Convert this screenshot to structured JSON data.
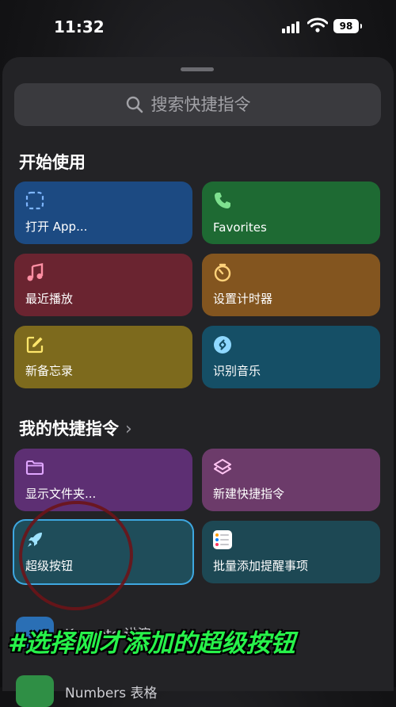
{
  "status_bar": {
    "time": "11:32",
    "battery": "98"
  },
  "search": {
    "placeholder": "搜索快捷指令"
  },
  "sections": {
    "getting_started": "开始使用",
    "my_shortcuts": "我的快捷指令"
  },
  "getting_started_tiles": [
    {
      "label": "打开 App...",
      "icon": "dashed-square-icon",
      "color": "#1c4a82"
    },
    {
      "label": "Favorites",
      "icon": "phone-icon",
      "color": "#1e6a33"
    },
    {
      "label": "最近播放",
      "icon": "music-note-icon",
      "color": "#6a2430"
    },
    {
      "label": "设置计时器",
      "icon": "timer-icon",
      "color": "#83551f"
    },
    {
      "label": "新备忘录",
      "icon": "compose-icon",
      "color": "#7d6a1d"
    },
    {
      "label": "识别音乐",
      "icon": "shazam-icon",
      "color": "#154f66"
    }
  ],
  "my_shortcut_tiles": [
    {
      "label": "显示文件夹...",
      "icon": "folder-icon",
      "color": "#5d2f73"
    },
    {
      "label": "新建快捷指令",
      "icon": "layers-icon",
      "color": "#6c3b6a"
    },
    {
      "label": "超级按钮",
      "icon": "rocket-icon",
      "color": "#1f4d5a",
      "selected": true
    },
    {
      "label": "批量添加提醒事项",
      "icon": "reminders-icon",
      "color": "#1d4854"
    }
  ],
  "list_rows": [
    {
      "label": "Keynote 讲演"
    },
    {
      "label": "Numbers 表格"
    }
  ],
  "caption": "#选择刚才添加的超级按钮",
  "colors": {
    "accent": "#3ea7e0",
    "caption": "#27f24a",
    "annotation_circle": "#6b1418"
  }
}
